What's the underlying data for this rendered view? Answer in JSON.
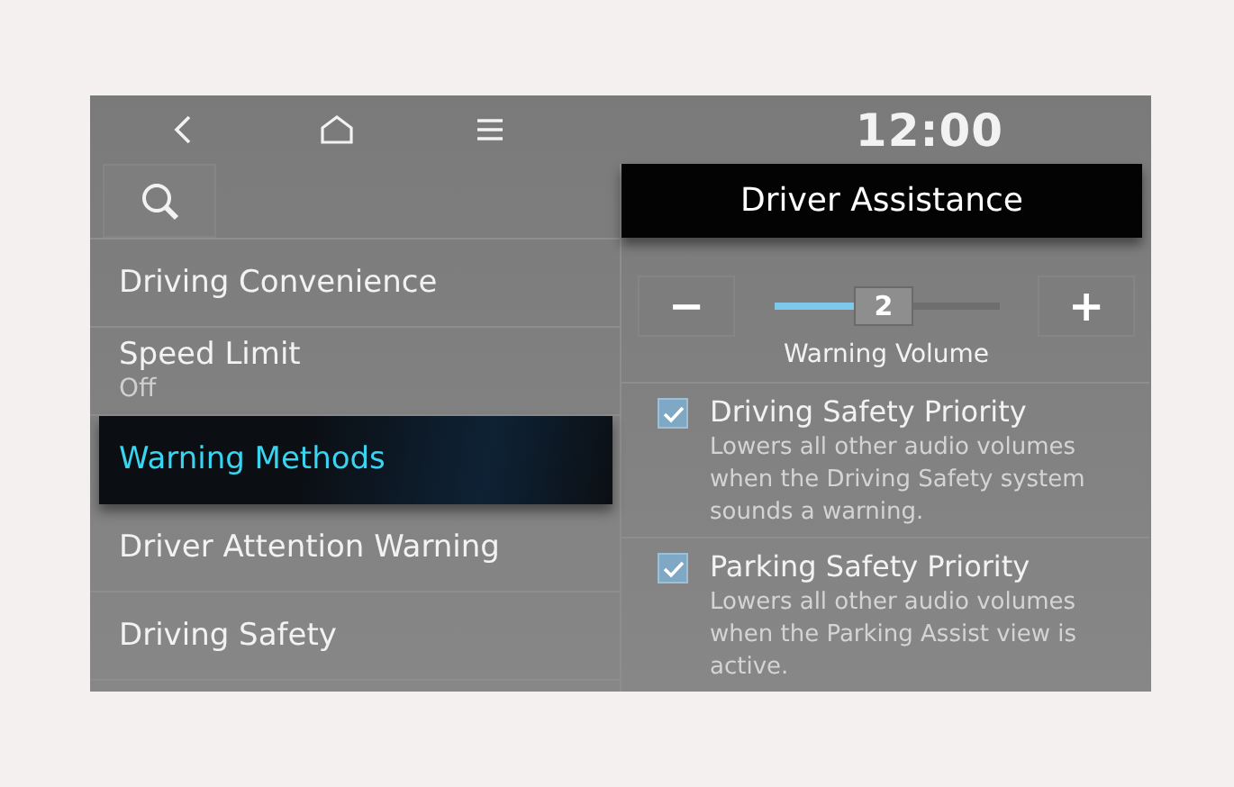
{
  "clock": "12:00",
  "menu": [
    {
      "label": "Driving Convenience",
      "selected": false
    },
    {
      "label": "Speed Limit",
      "sublabel": "Off",
      "selected": false
    },
    {
      "label": "Warning Methods",
      "selected": true
    },
    {
      "label": "Driver Attention Warning",
      "selected": false
    },
    {
      "label": "Driving Safety",
      "selected": false
    }
  ],
  "panel": {
    "title": "Driver Assistance",
    "volume": {
      "decrease": "−",
      "increase": "+",
      "value": "2",
      "level": 0.36,
      "label": "Warning Volume"
    },
    "options": [
      {
        "label": "Driving Safety Priority",
        "description": "Lowers all other audio volumes when the Driving Safety system sounds a warning.",
        "checked": true
      },
      {
        "label": "Parking Safety Priority",
        "description": "Lowers all other audio volumes when the Parking Assist view is active.",
        "checked": true
      }
    ]
  }
}
